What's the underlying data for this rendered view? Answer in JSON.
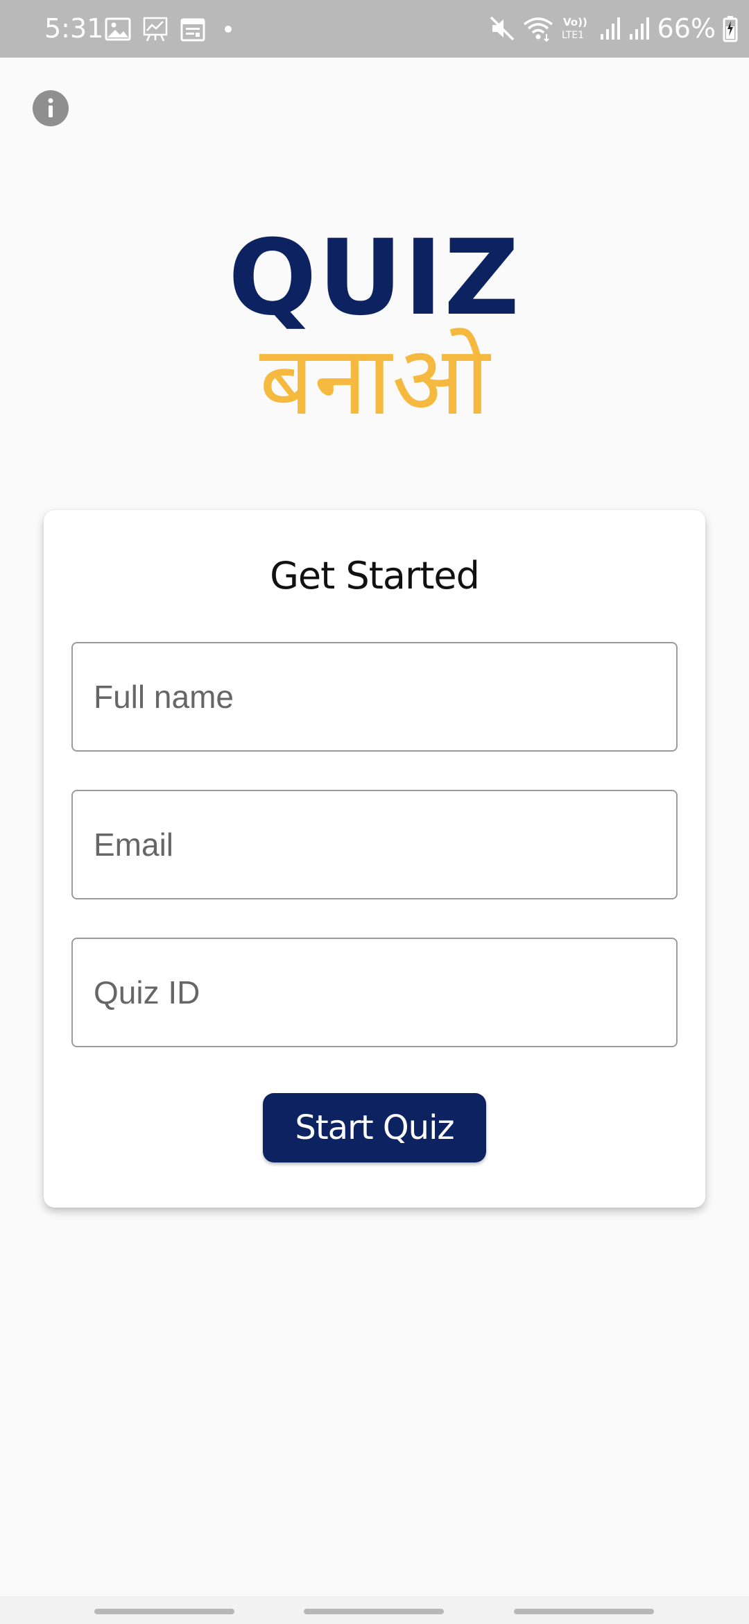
{
  "status_bar": {
    "time": "5:31",
    "battery": "66%",
    "network_label": "LTE1",
    "icons": [
      "gallery-icon",
      "chart-icon",
      "calendar-icon",
      "mute-icon",
      "wifi-icon",
      "volte-icon",
      "signal-icon",
      "signal-icon",
      "battery-icon"
    ]
  },
  "header": {
    "info_icon": "info-icon"
  },
  "logo": {
    "title": "QUIZ",
    "subtitle": "बनाओ",
    "title_color": "#0d2260",
    "subtitle_color": "#f5b940"
  },
  "form": {
    "title": "Get Started",
    "fields": [
      {
        "placeholder": "Full name",
        "value": ""
      },
      {
        "placeholder": "Email",
        "value": ""
      },
      {
        "placeholder": "Quiz ID",
        "value": ""
      }
    ],
    "submit_label": "Start Quiz",
    "submit_color": "#0d2260"
  }
}
